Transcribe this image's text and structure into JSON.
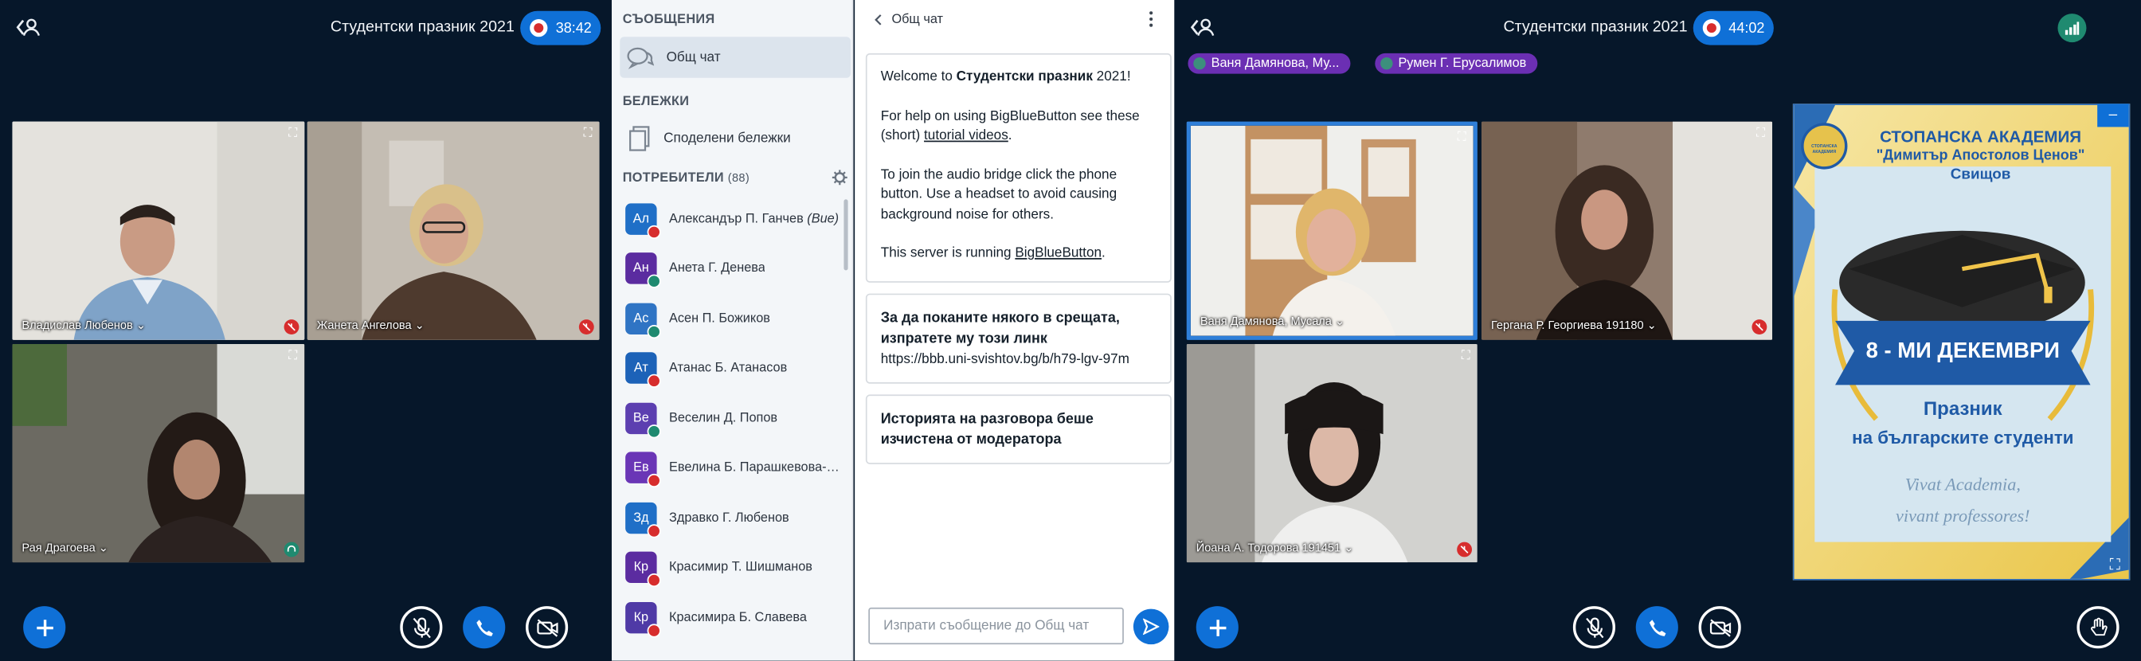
{
  "left": {
    "title": "Студентски празник 2021",
    "timer": "38:42",
    "tiles": [
      {
        "name": "Владислав Любенов",
        "mic": "muted"
      },
      {
        "name": "Жанета Ангелова",
        "mic": "muted"
      },
      {
        "name": "Рая Драгоева",
        "mic": "listen"
      }
    ]
  },
  "panel": {
    "messages_header": "СЪОБЩЕНИЯ",
    "public_chat": "Общ чат",
    "notes_header": "БЕЛЕЖКИ",
    "shared_notes": "Споделени бележки",
    "users_header": "ПОТРЕБИТЕЛИ",
    "users_count": "(88)",
    "users": [
      {
        "initials": "Ал",
        "name": "Александър П. Ганчев",
        "suffix": "(Вие)",
        "color": "#1f6fc7",
        "status": "muted"
      },
      {
        "initials": "Ан",
        "name": "Анета Г. Денева",
        "suffix": "",
        "color": "#5b2ca0",
        "status": "listen"
      },
      {
        "initials": "Ас",
        "name": "Асен П. Божиков",
        "suffix": "",
        "color": "#2f74c4",
        "status": "listen"
      },
      {
        "initials": "Ат",
        "name": "Атанас Б. Атанасов",
        "suffix": "",
        "color": "#1c62b8",
        "status": "muted"
      },
      {
        "initials": "Ве",
        "name": "Веселин Д. Попов",
        "suffix": "",
        "color": "#5c3fb0",
        "status": "listen"
      },
      {
        "initials": "Ев",
        "name": "Евелина Б. Парашкевова-В...",
        "suffix": "",
        "color": "#6a36b6",
        "status": "muted"
      },
      {
        "initials": "Зд",
        "name": "Здравко Г. Любенов",
        "suffix": "",
        "color": "#1f6fc7",
        "status": "muted"
      },
      {
        "initials": "Кр",
        "name": "Красимир Т. Шишманов",
        "suffix": "",
        "color": "#5b2ca0",
        "status": "muted"
      },
      {
        "initials": "Кр",
        "name": "Красимира Б. Славева",
        "suffix": "",
        "color": "#4f3aa6",
        "status": "muted"
      }
    ]
  },
  "chat": {
    "back_label": "Общ чат",
    "welcome_prefix": "Welcome to ",
    "welcome_bold": "Студентски празник",
    "welcome_suffix": " 2021!",
    "help_text": "For help on using BigBlueButton see these (short) ",
    "help_link": "tutorial videos",
    "help_end": ".",
    "audio_text": "To join the audio bridge click the phone button. Use a headset to avoid causing background noise for others.",
    "server_text": "This server is running ",
    "server_link": "BigBlueButton",
    "server_end": ".",
    "invite_text": "За да поканите някого в срещата, изпратете му този линк",
    "invite_link": "https://bbb.uni-svishtov.bg/b/h79-lgv-97m",
    "cleared_text": "Историята на разговора беше изчистена от модератора",
    "input_placeholder": "Изпрати съобщение до Общ чат"
  },
  "right": {
    "title": "Студентски празник 2021",
    "timer": "44:02",
    "talkers": [
      "Ваня Дамянова, Му...",
      "Румен Г. Ерусалимов"
    ],
    "tiles": [
      {
        "name": "Ваня Дамянова, Мусала",
        "mic": "none"
      },
      {
        "name": "Гергана Р. Георгиева 191180",
        "mic": "muted"
      },
      {
        "name": "Йоана А. Тодорова 191451",
        "mic": "muted"
      }
    ],
    "poster": {
      "line1": "СТОПАНСКА АКАДЕМИЯ",
      "line2": "\"Димитър Апостолов Ценов\"",
      "line3": "Свищов",
      "seal_text": "СТОПАНСКА АКАДЕМИЯ",
      "date": "8 - МИ ДЕКЕМВРИ",
      "holiday1": "Празник",
      "holiday2": "на българските студенти",
      "motto1": "Vivat Academia,",
      "motto2": "vivant professores!"
    },
    "minimize": "–"
  }
}
